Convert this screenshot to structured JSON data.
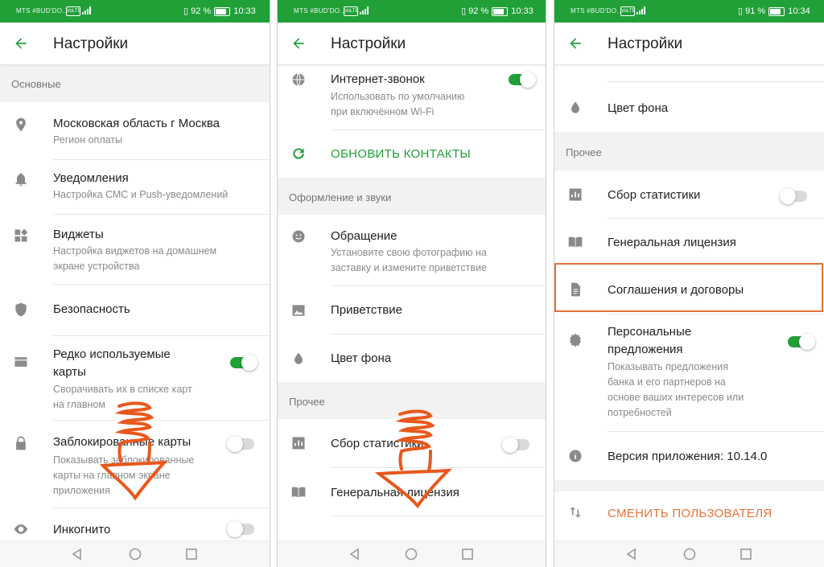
{
  "colors": {
    "accent": "#21a038",
    "orange": "#e8723b",
    "section_bg": "#f2f2f2"
  },
  "screens": [
    {
      "status": {
        "carrier": "MTS #BUD'DO…",
        "battery": "92 %",
        "time": "10:33"
      },
      "title": "Настройки",
      "sections": [
        {
          "label": "Основные"
        }
      ],
      "items": [
        {
          "icon": "location-pin-icon",
          "title": "Московская область г Москва",
          "subtitle": "Регион оплаты"
        },
        {
          "icon": "bell-icon",
          "title": "Уведомления",
          "subtitle": "Настройка СМС и Push-уведомлений"
        },
        {
          "icon": "widgets-icon",
          "title": "Виджеты",
          "subtitle_1": "Настройка виджетов на домашнем",
          "subtitle_2": "экране устройства"
        },
        {
          "icon": "shield-icon",
          "title": "Безопасность"
        },
        {
          "icon": "card-icon",
          "title_1": "Редко используемые",
          "title_2": "карты",
          "subtitle_1": "Сворачивать их в списке карт",
          "subtitle_2": "на главном",
          "toggle": "on"
        },
        {
          "icon": "lock-icon",
          "title": "Заблокированные карты",
          "subtitle_1": "Показывать заблокированные",
          "subtitle_2": "карты на главном экране",
          "subtitle_3": "приложения",
          "toggle": "off"
        },
        {
          "icon": "eye-icon",
          "title": "Инкогнито",
          "toggle": "off"
        }
      ]
    },
    {
      "status": {
        "carrier": "MTS #BUD'DO…",
        "battery": "92 %",
        "time": "10:33"
      },
      "title": "Настройки",
      "items": [
        {
          "icon": "globe-icon",
          "title": "Интернет-звонок",
          "subtitle_1": "Использовать по умолчанию",
          "subtitle_2": "при включённом Wi-Fi",
          "toggle": "on"
        },
        {
          "icon": "refresh-icon",
          "title": "ОБНОВИТЬ КОНТАКТЫ"
        },
        {
          "icon": "smiley-icon",
          "title": "Обращение",
          "subtitle_1": "Установите свою фотографию на",
          "subtitle_2": "заставку и измените приветствие"
        },
        {
          "icon": "image-icon",
          "title": "Приветствие"
        },
        {
          "icon": "drop-icon",
          "title": "Цвет фона"
        },
        {
          "icon": "bar-chart-icon",
          "title": "Сбор статистики",
          "toggle": "off"
        },
        {
          "icon": "book-icon",
          "title": "Генеральная лицензия"
        }
      ],
      "sections": [
        {
          "label": "Оформление и звуки"
        },
        {
          "label": "Прочее"
        }
      ]
    },
    {
      "status": {
        "carrier": "MTS #BUD'DO…",
        "battery": "91 %",
        "time": "10:34"
      },
      "title": "Настройки",
      "items": [
        {
          "icon": "drop-icon",
          "title": "Цвет фона"
        },
        {
          "icon": "bar-chart-icon",
          "title": "Сбор статистики",
          "toggle": "off"
        },
        {
          "icon": "book-icon",
          "title": "Генеральная лицензия"
        },
        {
          "icon": "document-icon",
          "title": "Соглашения и договоры"
        },
        {
          "icon": "badge-icon",
          "title_1": "Персональные",
          "title_2": "предложения",
          "subtitle_1": "Показывать предложения",
          "subtitle_2": "банка и его партнеров на",
          "subtitle_3": "основе ваших интересов или",
          "subtitle_4": "потребностей",
          "toggle": "on"
        },
        {
          "icon": "info-icon",
          "title": "Версия приложения: 10.14.0"
        },
        {
          "icon": "swap-icon",
          "title": "СМЕНИТЬ ПОЛЬЗОВАТЕЛЯ"
        }
      ],
      "sections": [
        {
          "label": "Прочее"
        }
      ]
    }
  ]
}
